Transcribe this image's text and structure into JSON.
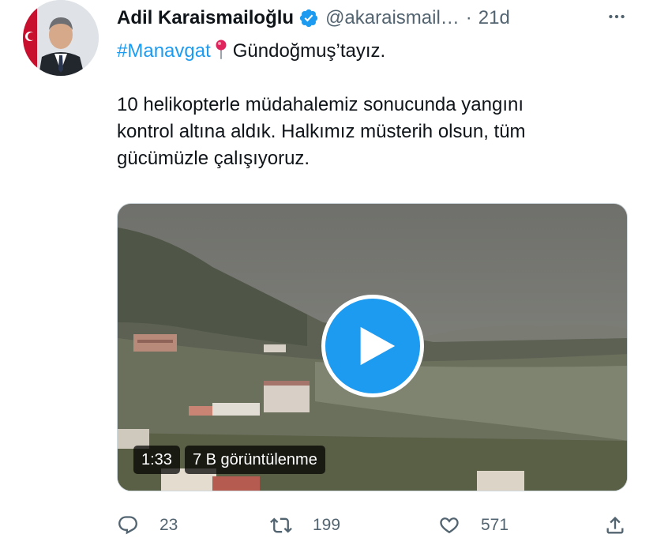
{
  "tweet": {
    "author_name": "Adil Karaismailoğlu",
    "handle": "@akaraismail…",
    "separator": "·",
    "time": "21d",
    "verified_icon": "verified-badge-icon",
    "more_icon": "more-options-icon",
    "text": {
      "hashtag": "#Manavgat",
      "pin_icon": "round-pushpin-icon",
      "line1_rest": "Gündoğmuş’tayız.",
      "line2": "",
      "line3": "10 helikopterle müdahalemiz sonucunda yangını",
      "line4": "kontrol altına aldık. Halkımız müsterih olsun, tüm",
      "line5": "gücümüzle çalışıyoruz."
    },
    "video": {
      "duration": "1:33",
      "views": "7 B görüntülenme",
      "play_icon": "play-icon"
    },
    "actions": {
      "reply_count": "23",
      "retweet_count": "199",
      "like_count": "571"
    }
  },
  "colors": {
    "accent": "#1d9bf0",
    "text_primary": "#0f1419",
    "text_secondary": "#536471",
    "pin": "#e0245e"
  }
}
